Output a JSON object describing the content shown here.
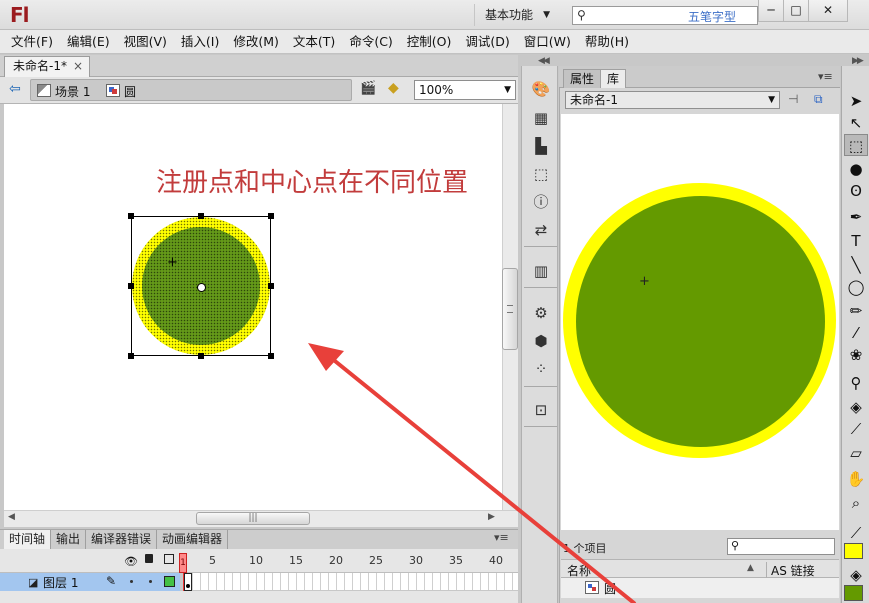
{
  "app": {
    "logo": "Fl",
    "workspace": "基本功能",
    "watermark": "五笔字型"
  },
  "window_buttons": {
    "minimize": "─",
    "maximize": "□",
    "close": "✕"
  },
  "menu": [
    "文件(F)",
    "编辑(E)",
    "视图(V)",
    "插入(I)",
    "修改(M)",
    "文本(T)",
    "命令(C)",
    "控制(O)",
    "调试(D)",
    "窗口(W)",
    "帮助(H)"
  ],
  "document_tab": {
    "label": "未命名-1*",
    "close": "×"
  },
  "editbar": {
    "scene": "场景 1",
    "symbol": "圆",
    "zoom": "100%"
  },
  "stage": {
    "annotation": "注册点和中心点在不同位置",
    "colors": {
      "stroke": "#ffff00",
      "fill": "#649919",
      "arrow": "#e8403a"
    }
  },
  "timeline": {
    "tabs": [
      "时间轴",
      "输出",
      "编译器错误",
      "动画编辑器"
    ],
    "frame_ticks": [
      "1",
      "5",
      "10",
      "15",
      "20",
      "25",
      "30",
      "35",
      "40"
    ],
    "layer": {
      "name": "图层 1",
      "color": "#44c044"
    }
  },
  "library": {
    "tabs": [
      "属性",
      "库"
    ],
    "document": "未命名-1",
    "item_count": "1 个项目",
    "columns": {
      "name": "名称",
      "linkage": "AS 链接"
    },
    "items": [
      {
        "name": "圆"
      }
    ],
    "preview_colors": {
      "stroke": "#ffff00",
      "fill": "#649a00"
    }
  },
  "tools": {
    "icons": [
      "selection-tool-icon",
      "subselection-tool-icon",
      "free-transform-tool-icon",
      "3d-rotation-tool-icon",
      "lasso-tool-icon",
      "pen-tool-icon",
      "text-tool-icon",
      "line-tool-icon",
      "oval-tool-icon",
      "pencil-tool-icon",
      "brush-tool-icon",
      "deco-tool-icon",
      "bone-tool-icon",
      "paint-bucket-tool-icon",
      "eyedropper-tool-icon",
      "eraser-tool-icon",
      "hand-tool-icon",
      "zoom-tool-icon"
    ],
    "stroke_color": "#ffff00",
    "fill_color": "#649a00"
  },
  "dock": {
    "icons": [
      "color-panel-icon",
      "swatches-icon",
      "align-icon",
      "transform-icon",
      "info-icon",
      "motion-presets-icon",
      "library-icon",
      "actions-icon",
      "components-icon",
      "component-inspector-icon",
      "movie-explorer-icon"
    ]
  }
}
